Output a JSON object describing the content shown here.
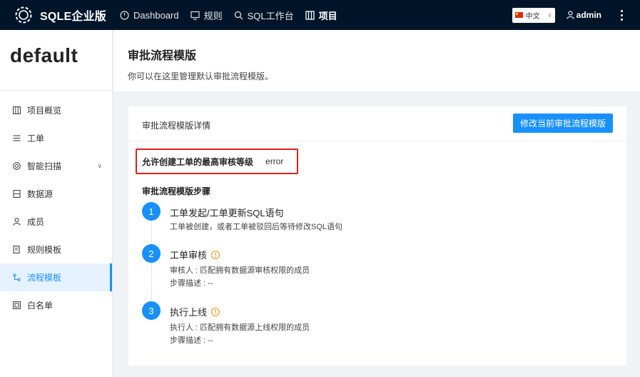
{
  "topbar": {
    "brand": "SQLE企业版",
    "nav": [
      {
        "label": "Dashboard",
        "icon": "dashboard-icon"
      },
      {
        "label": "规则",
        "icon": "monitor-icon"
      },
      {
        "label": "SQL工作台",
        "icon": "search-icon"
      },
      {
        "label": "项目",
        "icon": "project-icon"
      }
    ],
    "language": "中文",
    "user": "admin"
  },
  "sidebar": {
    "project_name": "default",
    "items": [
      {
        "label": "项目概览",
        "icon": "overview-icon"
      },
      {
        "label": "工单",
        "icon": "list-icon"
      },
      {
        "label": "智能扫描",
        "icon": "scan-icon"
      },
      {
        "label": "数据源",
        "icon": "datasource-icon"
      },
      {
        "label": "成员",
        "icon": "user-icon"
      },
      {
        "label": "规则模板",
        "icon": "rule-template-icon"
      },
      {
        "label": "流程模板",
        "icon": "workflow-icon"
      },
      {
        "label": "白名单",
        "icon": "whitelist-icon"
      }
    ],
    "active_index": 6
  },
  "page": {
    "title": "审批流程模版",
    "description": "你可以在这里管理默认审批流程模版。"
  },
  "card": {
    "title": "审批流程模版详情",
    "edit_button": "修改当前审批流程模版",
    "level_label": "允许创建工单的最高审核等级",
    "level_value": "error",
    "steps_title": "审批流程模版步骤",
    "steps": [
      {
        "num": "1",
        "title": "工单发起/工单更新SQL语句",
        "lines": [
          "工单被创建，或者工单被驳回后等待修改SQL语句"
        ],
        "info": false
      },
      {
        "num": "2",
        "title": "工单审核",
        "lines": [
          "审核人 : 匹配拥有数据源审核权限的成员",
          "步骤描述 : --"
        ],
        "info": true
      },
      {
        "num": "3",
        "title": "执行上线",
        "lines": [
          "执行人 : 匹配拥有数据源上线权限的成员",
          "步骤描述 : --"
        ],
        "info": true
      }
    ]
  },
  "colors": {
    "topbar_bg": "#001529",
    "primary": "#1890ff",
    "highlight_border": "#e02020",
    "warning": "#fa8c16"
  }
}
